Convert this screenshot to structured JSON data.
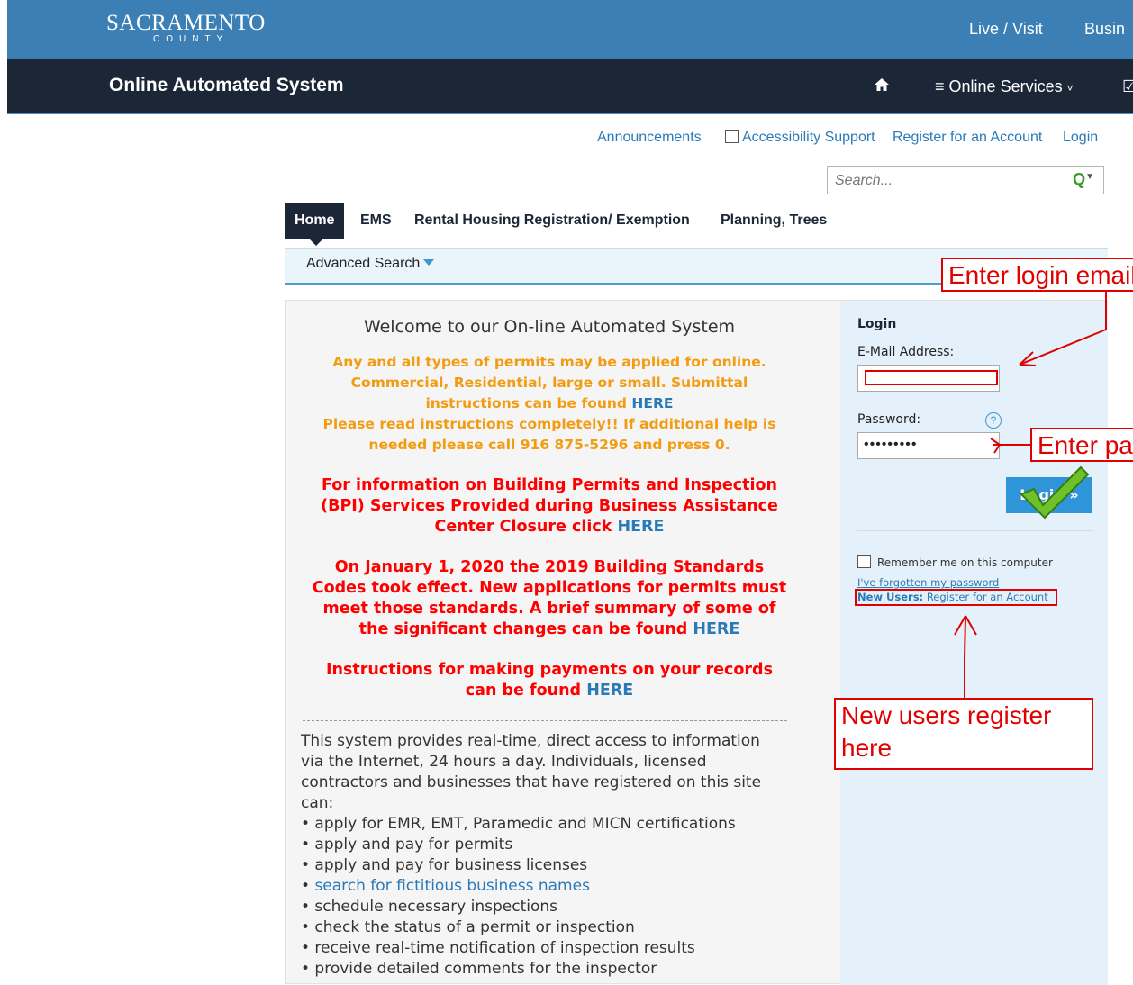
{
  "header": {
    "logo_main": "SACRAMENTO",
    "logo_sub": "COUNTY",
    "nav": [
      "Live / Visit",
      "Busin"
    ]
  },
  "navbar": {
    "title": "Online Automated System",
    "online_services": "Online Services"
  },
  "utility": {
    "announcements": "Announcements",
    "accessibility": "Accessibility Support",
    "register": "Register for an Account",
    "login": "Login"
  },
  "search": {
    "placeholder": "Search..."
  },
  "tabs": [
    "Home",
    "EMS",
    "Rental Housing Registration/ Exemption",
    "Planning, Trees"
  ],
  "subbar": {
    "advanced_search": "Advanced Search"
  },
  "welcome": {
    "title": "Welcome to our On-line Automated System",
    "orange_1": "Any and all types of permits may be applied for online. Commercial, Residential, large or small. Submittal instructions can be found",
    "orange_2": "Please read instructions completely!! If additional help is needed please call 916 875-5296 and press 0.",
    "red_1": "For information on Building Permits and Inspection (BPI) Services Provided during Business Assistance Center Closure click",
    "red_2": "On January 1, 2020 the 2019 Building Standards Codes took effect. New applications for permits must meet those standards. A brief summary of some of the significant changes can be found",
    "red_3": "Instructions for making payments on your records can be found",
    "here": "HERE"
  },
  "body": {
    "intro": "This system provides real-time, direct access to information via the Internet, 24 hours a day. Individuals, licensed contractors and businesses that have registered on this site can:",
    "items": [
      "• apply for EMR, EMT, Paramedic and MICN certifications",
      "• apply and pay for permits",
      "• apply and pay for business licenses",
      "search for fictitious business names",
      "• schedule necessary inspections",
      "• check the status of a permit or inspection",
      "• receive real-time notification of inspection results",
      "• provide detailed comments for the inspector"
    ]
  },
  "login": {
    "heading": "Login",
    "email_label": "E-Mail Address:",
    "password_label": "Password:",
    "password_value": "•••••••••",
    "button": "Login »",
    "remember": "Remember me on this computer",
    "forgot": "I've forgotten my password",
    "new_users": "New Users:",
    "register_link": "Register for an Account"
  },
  "annotations": {
    "email": "Enter login email",
    "password": "Enter password",
    "register": "New users register here"
  },
  "colors": {
    "header_blue": "#3b7fb5",
    "navbar_dark": "#1b2637",
    "annotation_red": "#e00000",
    "orange_text": "#f39c12"
  }
}
